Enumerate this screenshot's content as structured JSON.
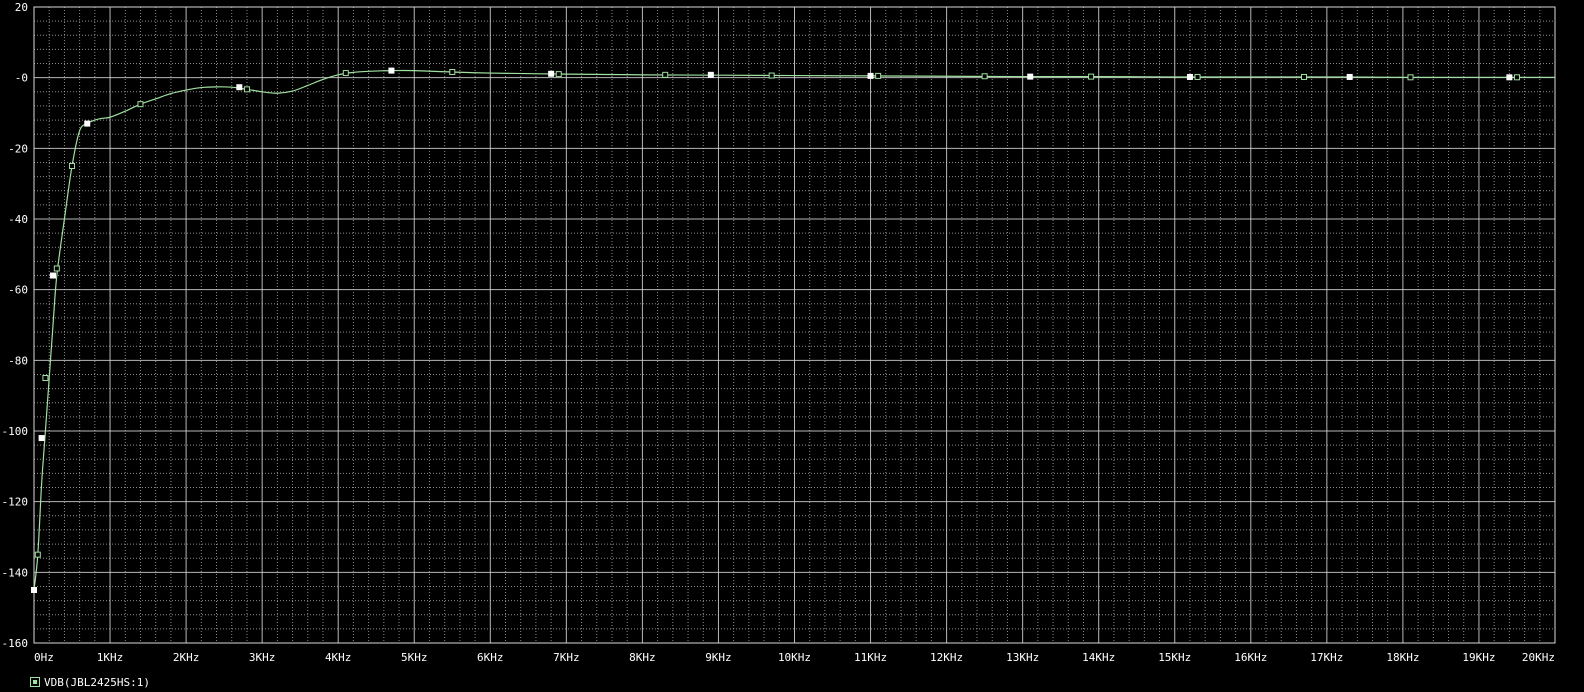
{
  "chart_data": {
    "type": "line",
    "title": "",
    "xlabel": "",
    "ylabel": "",
    "xlim": [
      0,
      20000
    ],
    "ylim": [
      -160,
      20
    ],
    "x_ticks": [
      0,
      1000,
      2000,
      3000,
      4000,
      5000,
      6000,
      7000,
      8000,
      9000,
      10000,
      11000,
      12000,
      13000,
      14000,
      15000,
      16000,
      17000,
      18000,
      19000,
      20000
    ],
    "x_tick_labels": [
      "0Hz",
      "1KHz",
      "2KHz",
      "3KHz",
      "4KHz",
      "5KHz",
      "6KHz",
      "7KHz",
      "8KHz",
      "9KHz",
      "10KHz",
      "11KHz",
      "12KHz",
      "13KHz",
      "14KHz",
      "15KHz",
      "16KHz",
      "17KHz",
      "18KHz",
      "19KHz",
      "20KHz"
    ],
    "y_ticks": [
      20,
      0,
      -20,
      -40,
      -60,
      -80,
      -100,
      -120,
      -140,
      -160
    ],
    "y_tick_labels": [
      "20",
      "-0",
      "-20",
      "-40",
      "-60",
      "-80",
      "-100",
      "-120",
      "-140",
      "-160"
    ],
    "grid": true,
    "series": [
      {
        "name": "VDB(JBL2425HS:1)",
        "color": "#a0e0a0",
        "x": [
          0,
          50,
          100,
          150,
          200,
          250,
          300,
          400,
          500,
          600,
          700,
          800,
          900,
          1000,
          1200,
          1400,
          1600,
          1800,
          2000,
          2200,
          2400,
          2600,
          2800,
          3000,
          3200,
          3400,
          3600,
          3800,
          4000,
          4200,
          4400,
          4700,
          5000,
          5500,
          6000,
          7000,
          8000,
          9000,
          10000,
          11000,
          12000,
          13000,
          14000,
          15000,
          16000,
          17000,
          18000,
          19000,
          20000
        ],
        "values": [
          -145,
          -135,
          -115,
          -100,
          -85,
          -70,
          -56,
          -40,
          -25,
          -15,
          -13,
          -12,
          -11.5,
          -11.2,
          -9.5,
          -7.5,
          -6,
          -4.5,
          -3.5,
          -2.8,
          -2.6,
          -2.7,
          -3.3,
          -4,
          -4.4,
          -3.8,
          -2.2,
          -0.5,
          0.8,
          1.5,
          1.8,
          2.0,
          2.0,
          1.6,
          1.3,
          1.0,
          0.8,
          0.7,
          0.6,
          0.5,
          0.4,
          0.3,
          0.3,
          0.2,
          0.2,
          0.2,
          0.1,
          0.1,
          0.1
        ]
      }
    ],
    "markers_square_x": [
      0,
      100,
      250,
      700,
      2700,
      4700,
      6800,
      8900,
      11000,
      13100,
      15200,
      17300,
      19400
    ],
    "markers_square_y": [
      -145,
      -102,
      -56,
      -13,
      -2.7,
      2.0,
      1.1,
      0.8,
      0.5,
      0.3,
      0.2,
      0.2,
      0.1
    ],
    "markers_hollow_x": [
      50,
      150,
      300,
      500,
      1400,
      2800,
      4100,
      5500,
      6900,
      8300,
      9700,
      11100,
      12500,
      13900,
      15300,
      16700,
      18100,
      19500
    ],
    "markers_hollow_y": [
      -135,
      -85,
      -54,
      -25,
      -7.5,
      -3.3,
      1.3,
      1.6,
      1.0,
      0.8,
      0.6,
      0.5,
      0.4,
      0.3,
      0.2,
      0.2,
      0.1,
      0.1
    ]
  },
  "legend": {
    "label": "VDB(JBL2425HS:1)"
  },
  "colors": {
    "background": "#000000",
    "grid_major": "#d8d8d8",
    "grid_minor": "#bcbcbc",
    "trace": "#a0e0a0",
    "tick_text": "#ffffff"
  }
}
